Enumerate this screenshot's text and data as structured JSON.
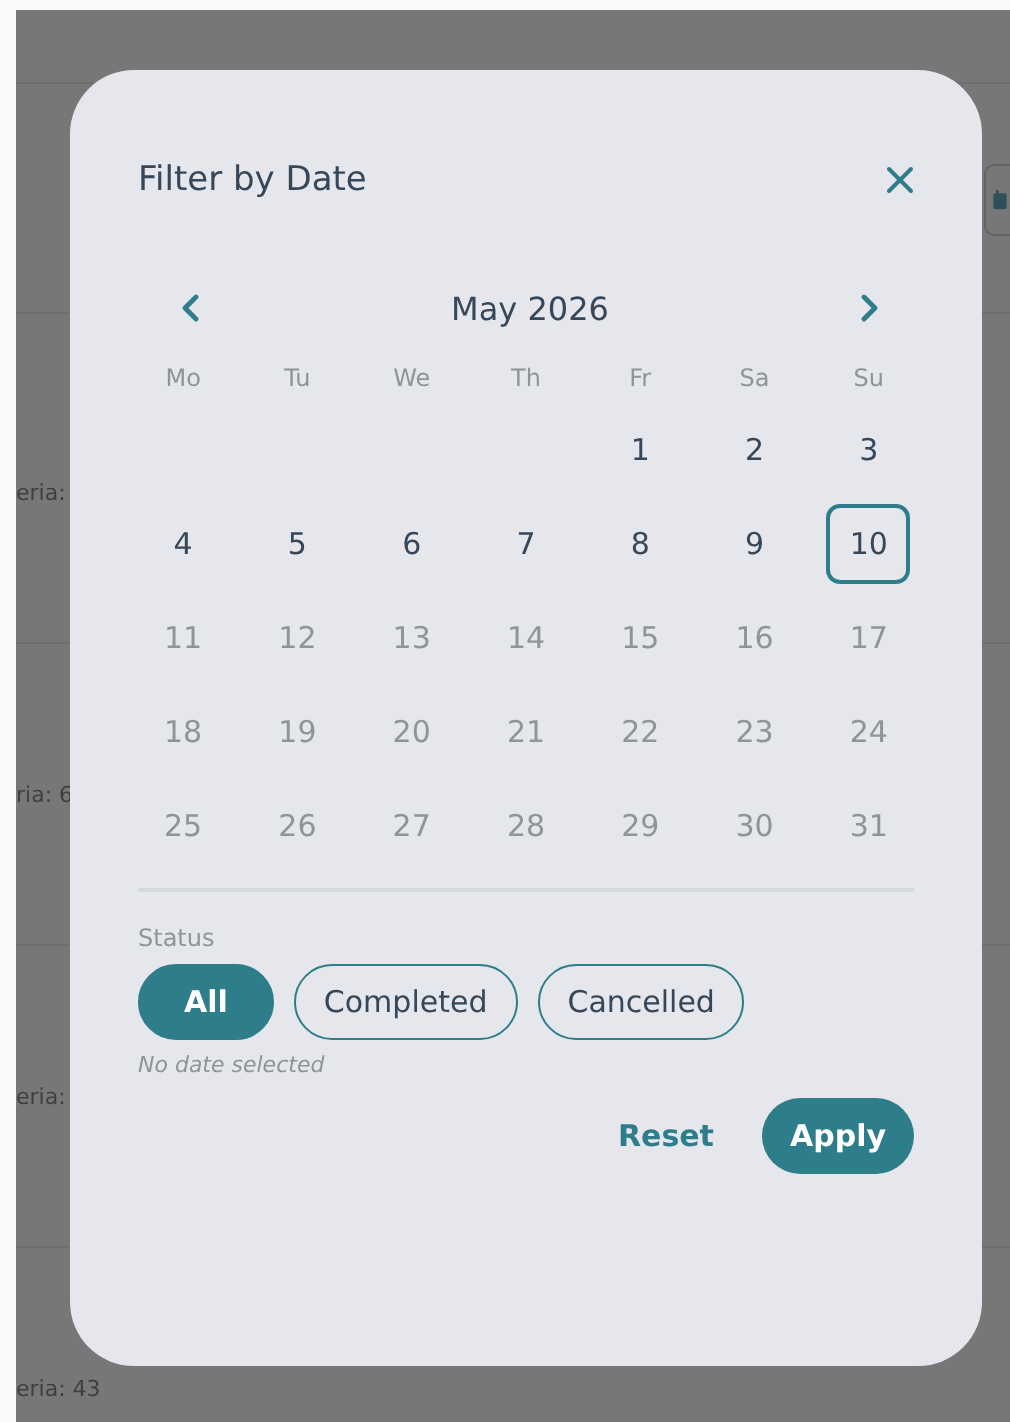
{
  "background": {
    "rows": [
      {
        "text": "eria:"
      },
      {
        "text": "ria: 6"
      },
      {
        "text": "eria:"
      },
      {
        "text": "eria: 43"
      }
    ]
  },
  "dialog": {
    "title": "Filter by Date",
    "month": "May 2026",
    "weekdays": [
      "Mo",
      "Tu",
      "We",
      "Th",
      "Fr",
      "Sa",
      "Su"
    ],
    "weeks": [
      {
        "days": [
          {
            "label": "1",
            "disabled": false,
            "today": false
          },
          {
            "label": "2",
            "disabled": false,
            "today": false
          },
          {
            "label": "3",
            "disabled": false,
            "today": false
          }
        ]
      },
      {
        "days": [
          {
            "label": "4",
            "disabled": false,
            "today": false
          },
          {
            "label": "5",
            "disabled": false,
            "today": false
          },
          {
            "label": "6",
            "disabled": false,
            "today": false
          },
          {
            "label": "7",
            "disabled": false,
            "today": false
          },
          {
            "label": "8",
            "disabled": false,
            "today": false
          },
          {
            "label": "9",
            "disabled": false,
            "today": false
          },
          {
            "label": "10",
            "disabled": false,
            "today": true
          }
        ]
      },
      {
        "days": [
          {
            "label": "11",
            "disabled": true,
            "today": false
          },
          {
            "label": "12",
            "disabled": true,
            "today": false
          },
          {
            "label": "13",
            "disabled": true,
            "today": false
          },
          {
            "label": "14",
            "disabled": true,
            "today": false
          },
          {
            "label": "15",
            "disabled": true,
            "today": false
          },
          {
            "label": "16",
            "disabled": true,
            "today": false
          },
          {
            "label": "17",
            "disabled": true,
            "today": false
          }
        ]
      },
      {
        "days": [
          {
            "label": "18",
            "disabled": true,
            "today": false
          },
          {
            "label": "19",
            "disabled": true,
            "today": false
          },
          {
            "label": "20",
            "disabled": true,
            "today": false
          },
          {
            "label": "21",
            "disabled": true,
            "today": false
          },
          {
            "label": "22",
            "disabled": true,
            "today": false
          },
          {
            "label": "23",
            "disabled": true,
            "today": false
          },
          {
            "label": "24",
            "disabled": true,
            "today": false
          }
        ]
      },
      {
        "days": [
          {
            "label": "25",
            "disabled": true,
            "today": false
          },
          {
            "label": "26",
            "disabled": true,
            "today": false
          },
          {
            "label": "27",
            "disabled": true,
            "today": false
          },
          {
            "label": "28",
            "disabled": true,
            "today": false
          },
          {
            "label": "29",
            "disabled": true,
            "today": false
          },
          {
            "label": "30",
            "disabled": true,
            "today": false
          },
          {
            "label": "31",
            "disabled": true,
            "today": false
          }
        ]
      }
    ],
    "status_label": "Status",
    "status_options": [
      {
        "label": "All",
        "selected": true
      },
      {
        "label": "Completed",
        "selected": false
      },
      {
        "label": "Cancelled",
        "selected": false
      }
    ],
    "note": "No date selected",
    "actions": [
      {
        "label": "Reset",
        "kind": "text"
      },
      {
        "label": "Apply",
        "kind": "filled"
      }
    ]
  }
}
